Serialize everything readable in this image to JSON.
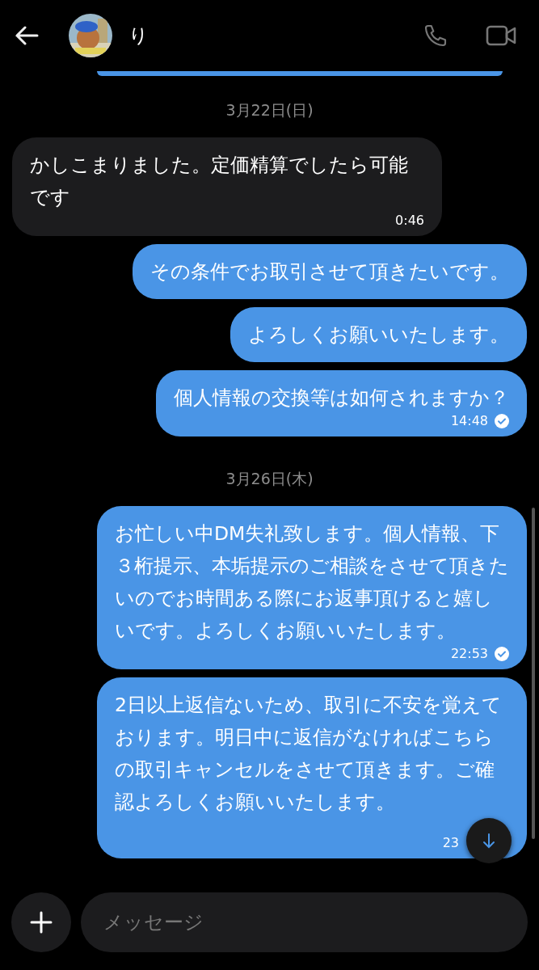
{
  "header": {
    "name": "り"
  },
  "messages": [
    {
      "kind": "partial"
    },
    {
      "kind": "date",
      "text": "3月22日(日)"
    },
    {
      "kind": "message",
      "outgoing": false,
      "text": "かしこまりました。定価精算でしたら可能です",
      "time": "0:46",
      "read": false
    },
    {
      "kind": "message",
      "text": "その条件でお取引させて頂きたいです。",
      "read": false,
      "outgoing": true
    },
    {
      "kind": "message",
      "outgoing": true,
      "text": "よろしくお願いいたします。",
      "read": false
    },
    {
      "kind": "message",
      "outgoing": true,
      "text": "個人情報の交換等は如何されますか？",
      "time": "14:48",
      "read": true
    },
    {
      "kind": "date",
      "text": "3月26日(木)"
    },
    {
      "kind": "message",
      "outgoing": true,
      "text": "お忙しい中DM失礼致します。個人情報、下３桁提示、本垢提示のご相談をさせて頂きたいのでお時間ある際にお返事頂けると嬉しいです。よろしくお願いいたします。",
      "time": "22:53",
      "read": true
    },
    {
      "kind": "message",
      "outgoing": true,
      "text": "2日以上返信ないため、取引に不安を覚えております。明日中に返信がなければこちらの取引キャンセルをさせて頂きます。ご確認よろしくお願いいたします。",
      "time": "23",
      "read": false
    }
  ],
  "composer": {
    "placeholder": "メッセージ"
  }
}
